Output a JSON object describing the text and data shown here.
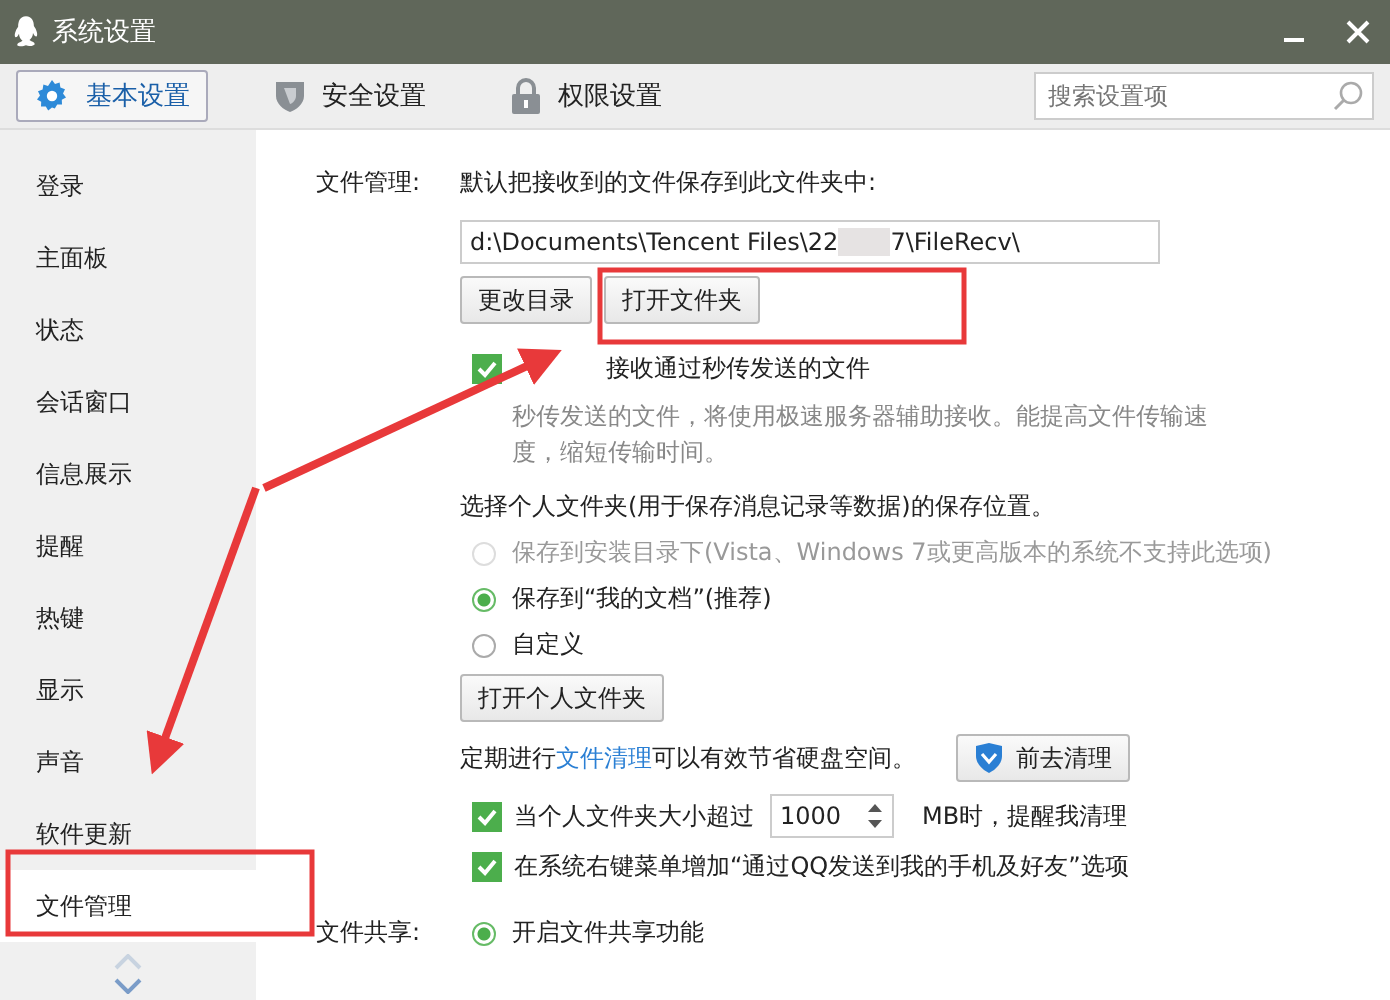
{
  "window": {
    "title": "系统设置"
  },
  "tabs": [
    {
      "label": "基本设置",
      "selected": true,
      "kind": "gear"
    },
    {
      "label": "安全设置",
      "selected": false,
      "kind": "shield"
    },
    {
      "label": "权限设置",
      "selected": false,
      "kind": "lock"
    }
  ],
  "search": {
    "placeholder": "搜索设置项"
  },
  "sidebar": {
    "items": [
      {
        "label": "登录",
        "selected": false
      },
      {
        "label": "主面板",
        "selected": false
      },
      {
        "label": "状态",
        "selected": false
      },
      {
        "label": "会话窗口",
        "selected": false
      },
      {
        "label": "信息展示",
        "selected": false
      },
      {
        "label": "提醒",
        "selected": false
      },
      {
        "label": "热键",
        "selected": false
      },
      {
        "label": "显示",
        "selected": false
      },
      {
        "label": "声音",
        "selected": false
      },
      {
        "label": "软件更新",
        "selected": false
      },
      {
        "label": "文件管理",
        "selected": true
      }
    ]
  },
  "file_management": {
    "label": "文件管理:",
    "intro": "默认把接收到的文件保存到此文件夹中:",
    "path_start": "d:\\Documents\\Tencent Files\\22",
    "path_end": "7\\FileRecv\\",
    "buttons": [
      "更改目录",
      "打开文件夹"
    ],
    "instant_transfer": {
      "label": "接收通过秒传发送的文件",
      "checked": true,
      "hint": "秒传发送的文件，将使用极速服务器辅助接收。能提高文件传输速度，缩短传输时间。"
    },
    "personal_folder_prompt": "选择个人文件夹(用于保存消息记录等数据)的保存位置。",
    "locations": [
      {
        "label": "保存到安装目录下(Vista、Windows 7或更高版本的系统不支持此选项)",
        "selected": false,
        "disabled": true
      },
      {
        "label": "保存到“我的文档”(推荐)",
        "selected": true,
        "disabled": false
      },
      {
        "label": "自定义",
        "selected": false,
        "disabled": false
      }
    ],
    "open_personal_button": "打开个人文件夹",
    "cleanup": {
      "before": "定期进行",
      "link": "文件清理",
      "after": "可以有效节省硬盘空间。",
      "button": "前去清理"
    },
    "size_limit": {
      "before": "当个人文件夹大小超过",
      "value": "1000",
      "after": "MB时，提醒我清理",
      "checked": true
    },
    "context_menu": {
      "label": "在系统右键菜单增加“通过QQ发送到我的手机及好友”选项",
      "checked": true
    }
  },
  "file_sharing": {
    "label": "文件共享:",
    "option": {
      "label": "开启文件共享功能",
      "selected": true
    }
  }
}
